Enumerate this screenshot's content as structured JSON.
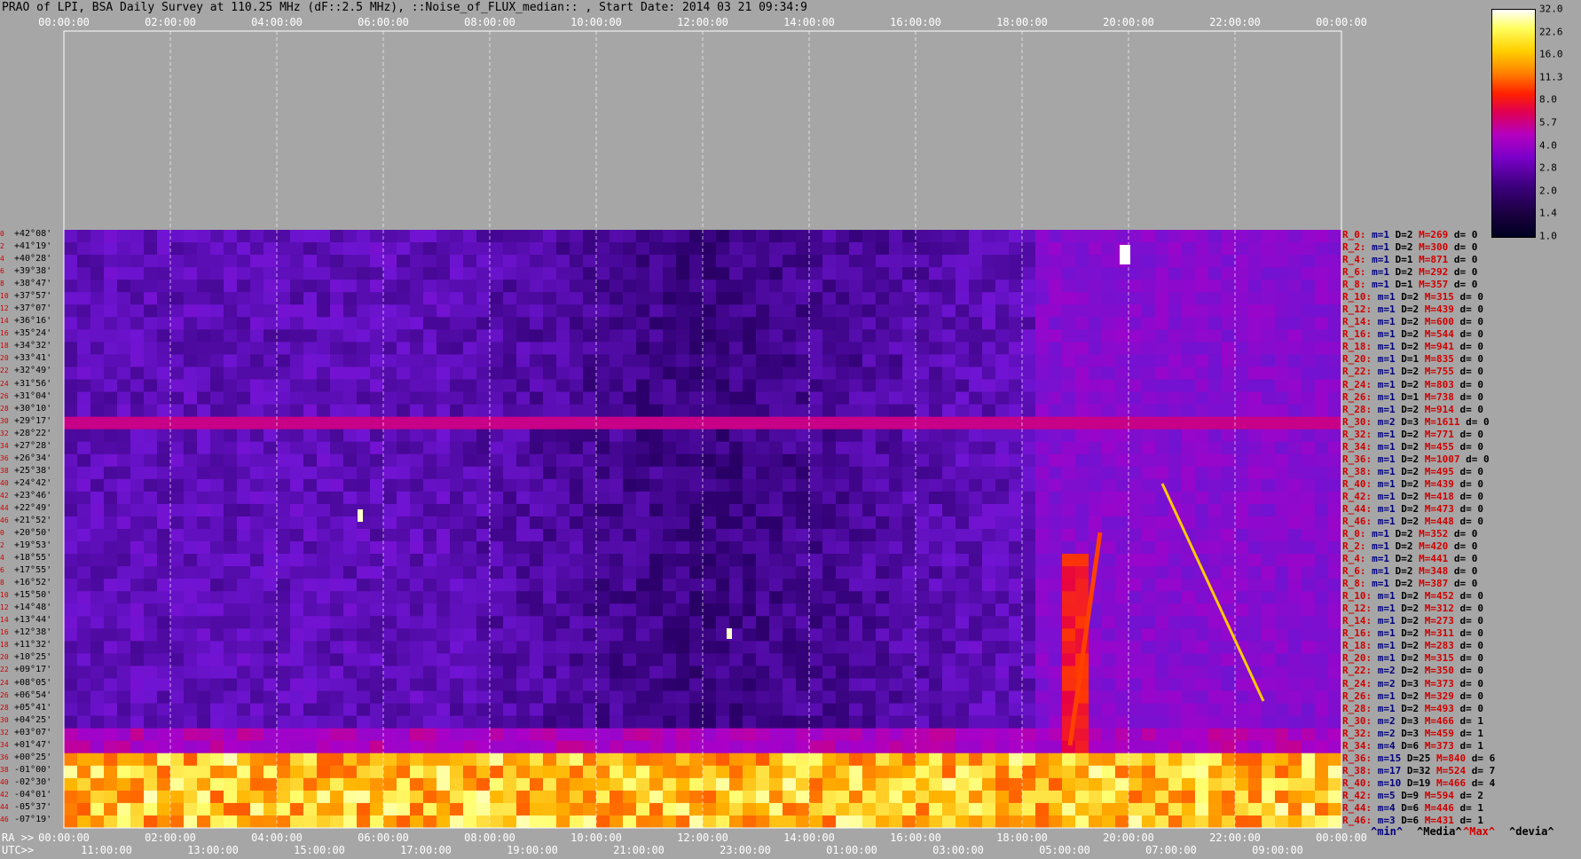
{
  "header": {
    "title": "PRAO of LPI, BSA Daily Survey at 110.25 MHz (dF::2.5 MHz), ::Noise_of_FLUX_median:: , Start Date: 2014 03 21 09:34:9"
  },
  "chart_data": {
    "type": "heatmap",
    "title": "PRAO of LPI, BSA Daily Survey at 110.25 MHz (dF::2.5 MHz), ::Noise_of_FLUX_median:: , Start Date: 2014 03 21 09:34:9",
    "x_top_ticks": [
      "00:00:00",
      "02:00:00",
      "04:00:00",
      "06:00:00",
      "08:00:00",
      "10:00:00",
      "12:00:00",
      "14:00:00",
      "16:00:00",
      "18:00:00",
      "20:00:00",
      "22:00:00",
      "00:00:00"
    ],
    "x_ra_ticks": [
      "00:00:00",
      "02:00:00",
      "04:00:00",
      "06:00:00",
      "08:00:00",
      "10:00:00",
      "12:00:00",
      "14:00:00",
      "16:00:00",
      "18:00:00",
      "20:00:00",
      "22:00:00",
      "00:00:00"
    ],
    "x_utc_ticks": [
      "11:00:00",
      "13:00:00",
      "15:00:00",
      "17:00:00",
      "19:00:00",
      "21:00:00",
      "23:00:00",
      "01:00:00",
      "03:00:00",
      "05:00:00",
      "07:00:00",
      "09:00:00"
    ],
    "ra_label": "RA >>",
    "utc_label": "UTC>>",
    "y_ticks": [
      "+42°08'",
      "+41°19'",
      "+40°28'",
      "+39°38'",
      "+38°47'",
      "+37°57'",
      "+37°07'",
      "+36°16'",
      "+35°24'",
      "+34°32'",
      "+33°41'",
      "+32°49'",
      "+31°56'",
      "+31°04'",
      "+30°10'",
      "+29°17'",
      "+28°22'",
      "+27°28'",
      "+26°34'",
      "+25°38'",
      "+24°42'",
      "+23°46'",
      "+22°49'",
      "+21°52'",
      "+20°50'",
      "+19°53'",
      "+18°55'",
      "+17°55'",
      "+16°52'",
      "+15°50'",
      "+14°48'",
      "+13°44'",
      "+12°38'",
      "+11°32'",
      "+10°25'",
      "+09°17'",
      "+08°05'",
      "+06°54'",
      "+05°41'",
      "+04°25'",
      "+03°07'",
      "+01°47'",
      "+00°25'",
      "-01°00'",
      "-02°30'",
      "-04°01'",
      "-05°37'",
      "-07°19'"
    ],
    "row_numbers": [
      "0",
      "2",
      "4",
      "6",
      "8",
      "10",
      "12",
      "14",
      "16",
      "18",
      "20",
      "22",
      "24",
      "26",
      "28",
      "30",
      "32",
      "34",
      "36",
      "38",
      "40",
      "42",
      "44",
      "46",
      "0",
      "2",
      "4",
      "6",
      "8",
      "10",
      "12",
      "14",
      "16",
      "18",
      "20",
      "22",
      "24",
      "26",
      "28",
      "30",
      "32",
      "34",
      "36",
      "38",
      "40",
      "42",
      "44",
      "46"
    ],
    "colorbar": {
      "ticks": [
        "32.0",
        "22.6",
        "16.0",
        "11.3",
        "8.0",
        "5.7",
        "4.0",
        "2.8",
        "2.0",
        "1.4",
        "1.0"
      ],
      "colors": [
        "#000020",
        "#3a007a",
        "#7a00c8",
        "#b400c0",
        "#e00050",
        "#ff2000",
        "#ff8000",
        "#ffd000",
        "#ffff60",
        "#ffffff"
      ]
    },
    "row_stats": [
      [
        "R_0:",
        "1",
        "2",
        "269",
        "0"
      ],
      [
        "R_2:",
        "1",
        "2",
        "300",
        "0"
      ],
      [
        "R_4:",
        "1",
        "1",
        "871",
        "0"
      ],
      [
        "R_6:",
        "1",
        "2",
        "292",
        "0"
      ],
      [
        "R_8:",
        "1",
        "1",
        "357",
        "0"
      ],
      [
        "R_10:",
        "1",
        "2",
        "315",
        "0"
      ],
      [
        "R_12:",
        "1",
        "2",
        "439",
        "0"
      ],
      [
        "R_14:",
        "1",
        "2",
        "600",
        "0"
      ],
      [
        "R_16:",
        "1",
        "2",
        "544",
        "0"
      ],
      [
        "R_18:",
        "1",
        "2",
        "941",
        "0"
      ],
      [
        "R_20:",
        "1",
        "1",
        "835",
        "0"
      ],
      [
        "R_22:",
        "1",
        "2",
        "755",
        "0"
      ],
      [
        "R_24:",
        "1",
        "2",
        "803",
        "0"
      ],
      [
        "R_26:",
        "1",
        "1",
        "738",
        "0"
      ],
      [
        "R_28:",
        "1",
        "2",
        "914",
        "0"
      ],
      [
        "R_30:",
        "2",
        "3",
        "1611",
        "0"
      ],
      [
        "R_32:",
        "1",
        "2",
        "771",
        "0"
      ],
      [
        "R_34:",
        "1",
        "2",
        "455",
        "0"
      ],
      [
        "R_36:",
        "1",
        "2",
        "1007",
        "0"
      ],
      [
        "R_38:",
        "1",
        "2",
        "495",
        "0"
      ],
      [
        "R_40:",
        "1",
        "2",
        "439",
        "0"
      ],
      [
        "R_42:",
        "1",
        "2",
        "418",
        "0"
      ],
      [
        "R_44:",
        "1",
        "2",
        "473",
        "0"
      ],
      [
        "R_46:",
        "1",
        "2",
        "448",
        "0"
      ],
      [
        "R_0:",
        "1",
        "2",
        "352",
        "0"
      ],
      [
        "R_2:",
        "1",
        "2",
        "420",
        "0"
      ],
      [
        "R_4:",
        "1",
        "2",
        "441",
        "0"
      ],
      [
        "R_6:",
        "1",
        "2",
        "348",
        "0"
      ],
      [
        "R_8:",
        "1",
        "2",
        "387",
        "0"
      ],
      [
        "R_10:",
        "1",
        "2",
        "452",
        "0"
      ],
      [
        "R_12:",
        "1",
        "2",
        "312",
        "0"
      ],
      [
        "R_14:",
        "1",
        "2",
        "273",
        "0"
      ],
      [
        "R_16:",
        "1",
        "2",
        "311",
        "0"
      ],
      [
        "R_18:",
        "1",
        "2",
        "283",
        "0"
      ],
      [
        "R_20:",
        "1",
        "2",
        "315",
        "0"
      ],
      [
        "R_22:",
        "2",
        "2",
        "350",
        "0"
      ],
      [
        "R_24:",
        "2",
        "3",
        "373",
        "0"
      ],
      [
        "R_26:",
        "1",
        "2",
        "329",
        "0"
      ],
      [
        "R_28:",
        "1",
        "2",
        "493",
        "0"
      ],
      [
        "R_30:",
        "2",
        "3",
        "466",
        "1"
      ],
      [
        "R_32:",
        "2",
        "3",
        "459",
        "1"
      ],
      [
        "R_34:",
        "4",
        "6",
        "373",
        "1"
      ],
      [
        "R_36:",
        "15",
        "25",
        "840",
        "6"
      ],
      [
        "R_38:",
        "17",
        "32",
        "524",
        "7"
      ],
      [
        "R_40:",
        "10",
        "19",
        "466",
        "4"
      ],
      [
        "R_42:",
        "5",
        "9",
        "594",
        "2"
      ],
      [
        "R_44:",
        "4",
        "6",
        "446",
        "1"
      ],
      [
        "R_46:",
        "3",
        "6",
        "431",
        "1"
      ]
    ],
    "stat_keys": {
      "min": "m=",
      "median": "D=",
      "max": "M=",
      "dev": "d="
    },
    "footer_legend": [
      "^min^",
      "^Media^",
      "^Max^",
      "^devia^"
    ],
    "grid": true
  }
}
